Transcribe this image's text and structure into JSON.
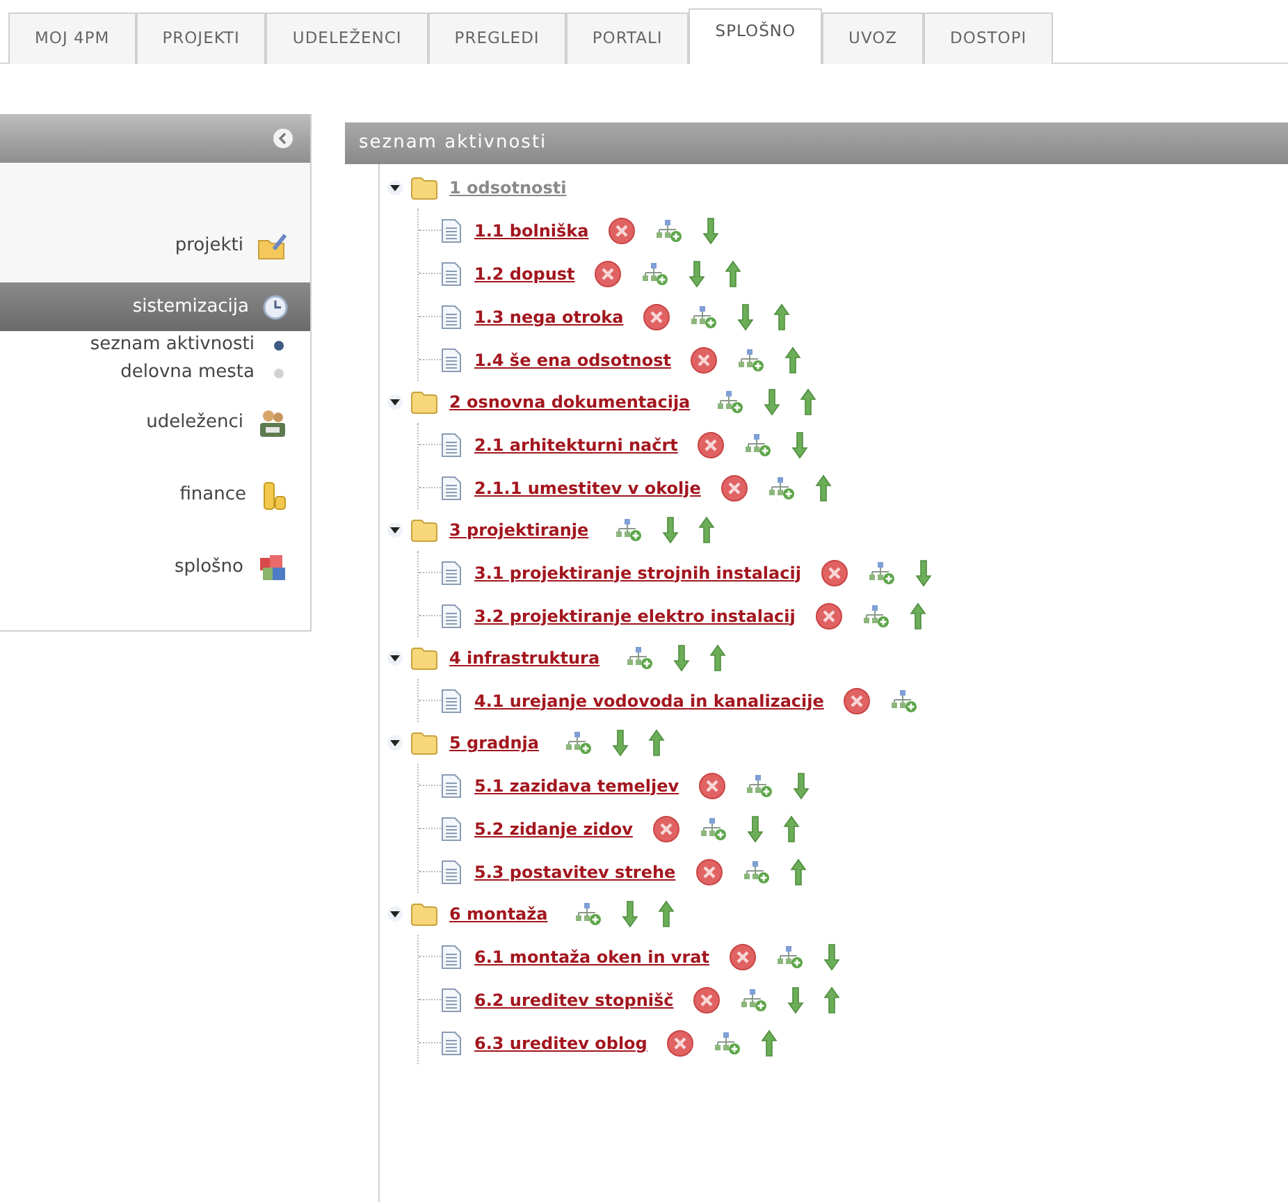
{
  "tabs": [
    {
      "label": "MOJ 4PM",
      "selected": false
    },
    {
      "label": "PROJEKTI",
      "selected": false
    },
    {
      "label": "UDELEŽENCI",
      "selected": false
    },
    {
      "label": "PREGLEDI",
      "selected": false
    },
    {
      "label": "PORTALI",
      "selected": false
    },
    {
      "label": "SPLOŠNO",
      "selected": true
    },
    {
      "label": "UVOZ",
      "selected": false
    },
    {
      "label": "DOSTOPI",
      "selected": false
    }
  ],
  "sidebar": {
    "items": [
      {
        "label": "projekti",
        "selected": false
      },
      {
        "label": "sistemizacija",
        "selected": true,
        "children": [
          {
            "label": "seznam aktivnosti",
            "selected": true
          },
          {
            "label": "delovna mesta",
            "selected": false
          }
        ]
      },
      {
        "label": "udeleženci",
        "selected": false
      },
      {
        "label": "finance",
        "selected": false
      },
      {
        "label": "splošno",
        "selected": false
      }
    ]
  },
  "panel": {
    "title": "seznam aktivnosti",
    "tree": [
      {
        "label": "1 odsotnosti",
        "expanded": true,
        "dimmed": true,
        "add": false,
        "down": false,
        "up": false,
        "children": [
          {
            "label": "1.1 bolniška",
            "delete": true,
            "add": true,
            "down": true,
            "up": false
          },
          {
            "label": "1.2 dopust",
            "delete": true,
            "add": true,
            "down": true,
            "up": true
          },
          {
            "label": "1.3 nega otroka",
            "delete": true,
            "add": true,
            "down": true,
            "up": true
          },
          {
            "label": "1.4 še ena odsotnost",
            "delete": true,
            "add": true,
            "down": false,
            "up": true
          }
        ]
      },
      {
        "label": "2 osnovna dokumentacija",
        "expanded": true,
        "dimmed": false,
        "add": true,
        "down": true,
        "up": true,
        "children": [
          {
            "label": "2.1 arhitekturni načrt",
            "delete": true,
            "add": true,
            "down": true,
            "up": false
          },
          {
            "label": "2.1.1 umestitev v okolje",
            "delete": true,
            "add": true,
            "down": false,
            "up": true
          }
        ]
      },
      {
        "label": "3 projektiranje",
        "expanded": true,
        "dimmed": false,
        "add": true,
        "down": true,
        "up": true,
        "children": [
          {
            "label": "3.1 projektiranje strojnih instalacij",
            "delete": true,
            "add": true,
            "down": true,
            "up": false
          },
          {
            "label": "3.2 projektiranje elektro instalacij",
            "delete": true,
            "add": true,
            "down": false,
            "up": true
          }
        ]
      },
      {
        "label": "4 infrastruktura",
        "expanded": true,
        "dimmed": false,
        "add": true,
        "down": true,
        "up": true,
        "children": [
          {
            "label": "4.1 urejanje vodovoda in kanalizacije",
            "delete": true,
            "add": true,
            "down": false,
            "up": false
          }
        ]
      },
      {
        "label": "5 gradnja",
        "expanded": true,
        "dimmed": false,
        "add": true,
        "down": true,
        "up": true,
        "children": [
          {
            "label": "5.1 zazidava temeljev",
            "delete": true,
            "add": true,
            "down": true,
            "up": false
          },
          {
            "label": "5.2 zidanje zidov",
            "delete": true,
            "add": true,
            "down": true,
            "up": true
          },
          {
            "label": "5.3 postavitev strehe",
            "delete": true,
            "add": true,
            "down": false,
            "up": true
          }
        ]
      },
      {
        "label": "6 montaža",
        "expanded": true,
        "dimmed": false,
        "add": true,
        "down": true,
        "up": true,
        "children": [
          {
            "label": "6.1 montaža oken in vrat",
            "delete": true,
            "add": true,
            "down": true,
            "up": false
          },
          {
            "label": "6.2 ureditev stopnišč",
            "delete": true,
            "add": true,
            "down": true,
            "up": true
          },
          {
            "label": "6.3 ureditev oblog",
            "delete": true,
            "add": true,
            "down": false,
            "up": true
          }
        ]
      }
    ]
  }
}
